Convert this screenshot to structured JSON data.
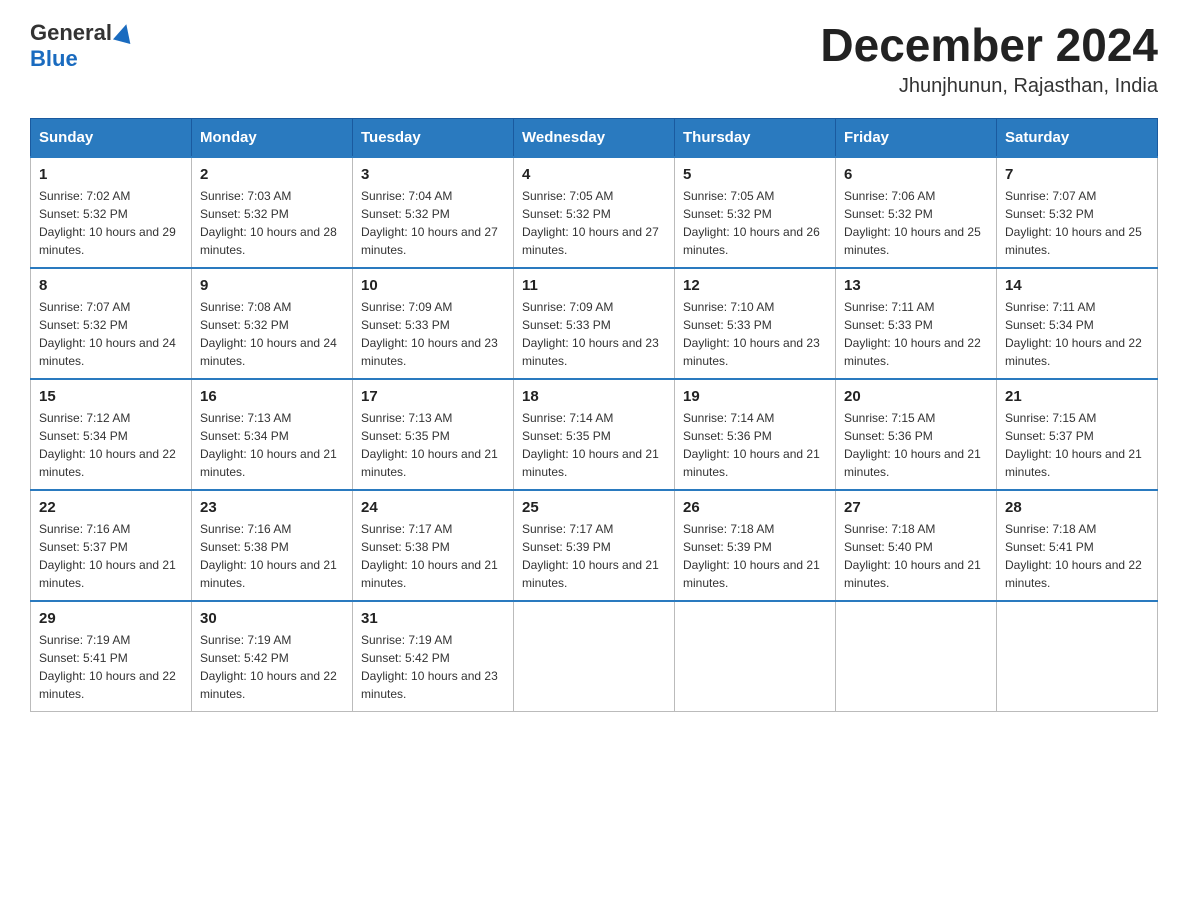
{
  "header": {
    "logo": {
      "general": "General",
      "blue": "Blue",
      "icon": "triangle"
    },
    "title": "December 2024",
    "location": "Jhunjhunun, Rajasthan, India"
  },
  "weekdays": [
    "Sunday",
    "Monday",
    "Tuesday",
    "Wednesday",
    "Thursday",
    "Friday",
    "Saturday"
  ],
  "weeks": [
    [
      {
        "day": "1",
        "sunrise": "7:02 AM",
        "sunset": "5:32 PM",
        "daylight": "10 hours and 29 minutes."
      },
      {
        "day": "2",
        "sunrise": "7:03 AM",
        "sunset": "5:32 PM",
        "daylight": "10 hours and 28 minutes."
      },
      {
        "day": "3",
        "sunrise": "7:04 AM",
        "sunset": "5:32 PM",
        "daylight": "10 hours and 27 minutes."
      },
      {
        "day": "4",
        "sunrise": "7:05 AM",
        "sunset": "5:32 PM",
        "daylight": "10 hours and 27 minutes."
      },
      {
        "day": "5",
        "sunrise": "7:05 AM",
        "sunset": "5:32 PM",
        "daylight": "10 hours and 26 minutes."
      },
      {
        "day": "6",
        "sunrise": "7:06 AM",
        "sunset": "5:32 PM",
        "daylight": "10 hours and 25 minutes."
      },
      {
        "day": "7",
        "sunrise": "7:07 AM",
        "sunset": "5:32 PM",
        "daylight": "10 hours and 25 minutes."
      }
    ],
    [
      {
        "day": "8",
        "sunrise": "7:07 AM",
        "sunset": "5:32 PM",
        "daylight": "10 hours and 24 minutes."
      },
      {
        "day": "9",
        "sunrise": "7:08 AM",
        "sunset": "5:32 PM",
        "daylight": "10 hours and 24 minutes."
      },
      {
        "day": "10",
        "sunrise": "7:09 AM",
        "sunset": "5:33 PM",
        "daylight": "10 hours and 23 minutes."
      },
      {
        "day": "11",
        "sunrise": "7:09 AM",
        "sunset": "5:33 PM",
        "daylight": "10 hours and 23 minutes."
      },
      {
        "day": "12",
        "sunrise": "7:10 AM",
        "sunset": "5:33 PM",
        "daylight": "10 hours and 23 minutes."
      },
      {
        "day": "13",
        "sunrise": "7:11 AM",
        "sunset": "5:33 PM",
        "daylight": "10 hours and 22 minutes."
      },
      {
        "day": "14",
        "sunrise": "7:11 AM",
        "sunset": "5:34 PM",
        "daylight": "10 hours and 22 minutes."
      }
    ],
    [
      {
        "day": "15",
        "sunrise": "7:12 AM",
        "sunset": "5:34 PM",
        "daylight": "10 hours and 22 minutes."
      },
      {
        "day": "16",
        "sunrise": "7:13 AM",
        "sunset": "5:34 PM",
        "daylight": "10 hours and 21 minutes."
      },
      {
        "day": "17",
        "sunrise": "7:13 AM",
        "sunset": "5:35 PM",
        "daylight": "10 hours and 21 minutes."
      },
      {
        "day": "18",
        "sunrise": "7:14 AM",
        "sunset": "5:35 PM",
        "daylight": "10 hours and 21 minutes."
      },
      {
        "day": "19",
        "sunrise": "7:14 AM",
        "sunset": "5:36 PM",
        "daylight": "10 hours and 21 minutes."
      },
      {
        "day": "20",
        "sunrise": "7:15 AM",
        "sunset": "5:36 PM",
        "daylight": "10 hours and 21 minutes."
      },
      {
        "day": "21",
        "sunrise": "7:15 AM",
        "sunset": "5:37 PM",
        "daylight": "10 hours and 21 minutes."
      }
    ],
    [
      {
        "day": "22",
        "sunrise": "7:16 AM",
        "sunset": "5:37 PM",
        "daylight": "10 hours and 21 minutes."
      },
      {
        "day": "23",
        "sunrise": "7:16 AM",
        "sunset": "5:38 PM",
        "daylight": "10 hours and 21 minutes."
      },
      {
        "day": "24",
        "sunrise": "7:17 AM",
        "sunset": "5:38 PM",
        "daylight": "10 hours and 21 minutes."
      },
      {
        "day": "25",
        "sunrise": "7:17 AM",
        "sunset": "5:39 PM",
        "daylight": "10 hours and 21 minutes."
      },
      {
        "day": "26",
        "sunrise": "7:18 AM",
        "sunset": "5:39 PM",
        "daylight": "10 hours and 21 minutes."
      },
      {
        "day": "27",
        "sunrise": "7:18 AM",
        "sunset": "5:40 PM",
        "daylight": "10 hours and 21 minutes."
      },
      {
        "day": "28",
        "sunrise": "7:18 AM",
        "sunset": "5:41 PM",
        "daylight": "10 hours and 22 minutes."
      }
    ],
    [
      {
        "day": "29",
        "sunrise": "7:19 AM",
        "sunset": "5:41 PM",
        "daylight": "10 hours and 22 minutes."
      },
      {
        "day": "30",
        "sunrise": "7:19 AM",
        "sunset": "5:42 PM",
        "daylight": "10 hours and 22 minutes."
      },
      {
        "day": "31",
        "sunrise": "7:19 AM",
        "sunset": "5:42 PM",
        "daylight": "10 hours and 23 minutes."
      },
      null,
      null,
      null,
      null
    ]
  ]
}
